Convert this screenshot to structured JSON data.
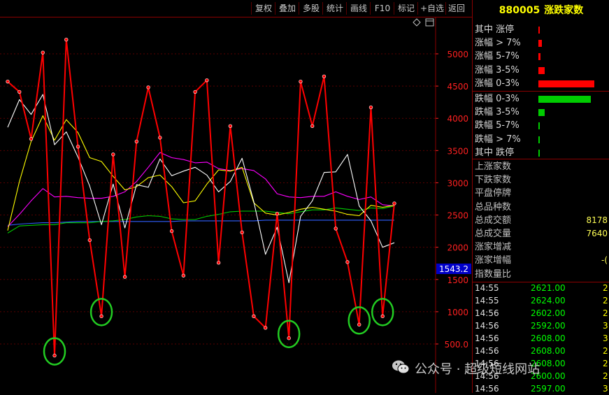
{
  "toolbar": {
    "buttons": [
      "复权",
      "叠加",
      "多股",
      "统计",
      "画线",
      "F10",
      "标记",
      "+自选",
      "返回"
    ]
  },
  "chart": {
    "price_tag": "1543.2",
    "diamond_icon": "diamond-icon",
    "expand_icon": "window-expand-icon"
  },
  "chart_data": {
    "type": "line",
    "y_ticks": [
      "5000",
      "4500",
      "4000",
      "3500",
      "3000",
      "2500",
      "2000",
      "1500",
      "1000",
      "500.0"
    ],
    "ylim": [
      200,
      5450
    ],
    "grid": true,
    "series": [
      {
        "color": "#ff0000",
        "values": [
          4570,
          4410,
          3680,
          5020,
          320,
          5220,
          3560,
          2110,
          930,
          3440,
          1540,
          3640,
          4480,
          3700,
          2250,
          1560,
          4410,
          4590,
          1760,
          3880,
          2230,
          930,
          750,
          2520,
          590,
          4570,
          3880,
          4650,
          2290,
          1770,
          800,
          4170,
          930,
          2680
        ]
      },
      {
        "color": "#ffffff",
        "values": [
          3860,
          4290,
          4060,
          4370,
          3590,
          3790,
          3400,
          2950,
          2350,
          2980,
          2300,
          2970,
          2930,
          3370,
          3110,
          3180,
          3240,
          3120,
          2860,
          3020,
          3380,
          2710,
          1890,
          2310,
          1450,
          2480,
          2720,
          3160,
          3170,
          3440,
          2640,
          2410,
          2000,
          2070
        ]
      },
      {
        "color": "#ffff00",
        "values": [
          2260,
          3020,
          3640,
          4040,
          3660,
          3980,
          3780,
          3390,
          3330,
          3100,
          2890,
          2940,
          3080,
          3120,
          2940,
          2690,
          2720,
          2980,
          3200,
          3180,
          3240,
          2690,
          2530,
          2500,
          2540,
          2590,
          2620,
          2590,
          2560,
          2510,
          2490,
          2650,
          2620,
          2650
        ]
      },
      {
        "color": "#ff00ff",
        "values": [
          2320,
          2510,
          2720,
          2910,
          2780,
          2790,
          2770,
          2760,
          2760,
          2790,
          2860,
          3020,
          3240,
          3470,
          3390,
          3360,
          3310,
          3320,
          3220,
          3190,
          3220,
          3190,
          3060,
          2830,
          2780,
          2770,
          2790,
          2790,
          2860,
          2790,
          2740,
          2780,
          2660,
          2640
        ]
      },
      {
        "color": "#00cc00",
        "values": [
          2220,
          2330,
          2340,
          2350,
          2350,
          2380,
          2380,
          2380,
          2400,
          2410,
          2430,
          2470,
          2490,
          2480,
          2440,
          2430,
          2430,
          2480,
          2510,
          2550,
          2560,
          2560,
          2560,
          2540,
          2520,
          2550,
          2580,
          2580,
          2610,
          2590,
          2570,
          2610,
          2600,
          2640
        ]
      },
      {
        "color": "#3060ff",
        "values": [
          2340,
          2360,
          2370,
          2380,
          2380,
          2390,
          2400,
          2400,
          2400,
          2400,
          2400,
          2400,
          2400,
          2400,
          2400,
          2410,
          2410,
          2410,
          2410,
          2410,
          2410,
          2410,
          2420,
          2420,
          2420,
          2420,
          2420,
          2420,
          2420,
          2420,
          2420,
          2420,
          2420,
          2420
        ]
      }
    ],
    "highlight_circles": [
      4,
      8,
      24,
      30,
      32
    ]
  },
  "panel": {
    "code": "880005",
    "name": "涨跌家数",
    "distribution": [
      {
        "label": "其中 涨停",
        "bar_color": "#ff0000",
        "fraction": 0.01
      },
      {
        "label": "涨幅 > 7%",
        "bar_color": "#ff0000",
        "fraction": 0.06
      },
      {
        "label": "涨幅 5-7%",
        "bar_color": "#ff0000",
        "fraction": 0.04
      },
      {
        "label": "涨幅 3-5%",
        "bar_color": "#ff0000",
        "fraction": 0.11
      },
      {
        "label": "涨幅 0-3%",
        "bar_color": "#ff0000",
        "fraction": 0.97
      },
      {
        "label": "跌幅 0-3%",
        "bar_color": "#00cc00",
        "fraction": 0.91
      },
      {
        "label": "跌幅 3-5%",
        "bar_color": "#00cc00",
        "fraction": 0.11
      },
      {
        "label": "跌幅 5-7%",
        "bar_color": "#00cc00",
        "fraction": 0.03
      },
      {
        "label": "跌幅 > 7%",
        "bar_color": "#00cc00",
        "fraction": 0.01
      },
      {
        "label": "其中 跌停",
        "bar_color": "#00cc00",
        "fraction": 0.01
      }
    ],
    "stats": [
      {
        "label": "上涨家数",
        "value": ""
      },
      {
        "label": "下跌家数",
        "value": ""
      },
      {
        "label": "平盘停牌",
        "value": ""
      },
      {
        "label": "总品种数",
        "value": ""
      },
      {
        "label": "总成交额",
        "value": "8178"
      },
      {
        "label": "总成交量",
        "value": "7640"
      },
      {
        "label": "涨家增减",
        "value": ""
      },
      {
        "label": "涨家增幅",
        "value": "-("
      },
      {
        "label": "指数量比",
        "value": ""
      }
    ],
    "ticks": [
      {
        "time": "14:55",
        "price": "2621.00",
        "vol": "2"
      },
      {
        "time": "14:55",
        "price": "2624.00",
        "vol": "2"
      },
      {
        "time": "14:56",
        "price": "2602.00",
        "vol": "2"
      },
      {
        "time": "14:56",
        "price": "2592.00",
        "vol": "3"
      },
      {
        "time": "14:56",
        "price": "2608.00",
        "vol": "3"
      },
      {
        "time": "14:56",
        "price": "2608.00",
        "vol": "2"
      },
      {
        "time": "14:56",
        "price": "2608.00",
        "vol": "2"
      },
      {
        "time": "14:56",
        "price": "2600.00",
        "vol": "2"
      },
      {
        "time": "14:56",
        "price": "2597.00",
        "vol": "3"
      }
    ]
  },
  "watermark": {
    "text": "公众号 · 超级短线网站",
    "icon": "wechat-icon"
  }
}
